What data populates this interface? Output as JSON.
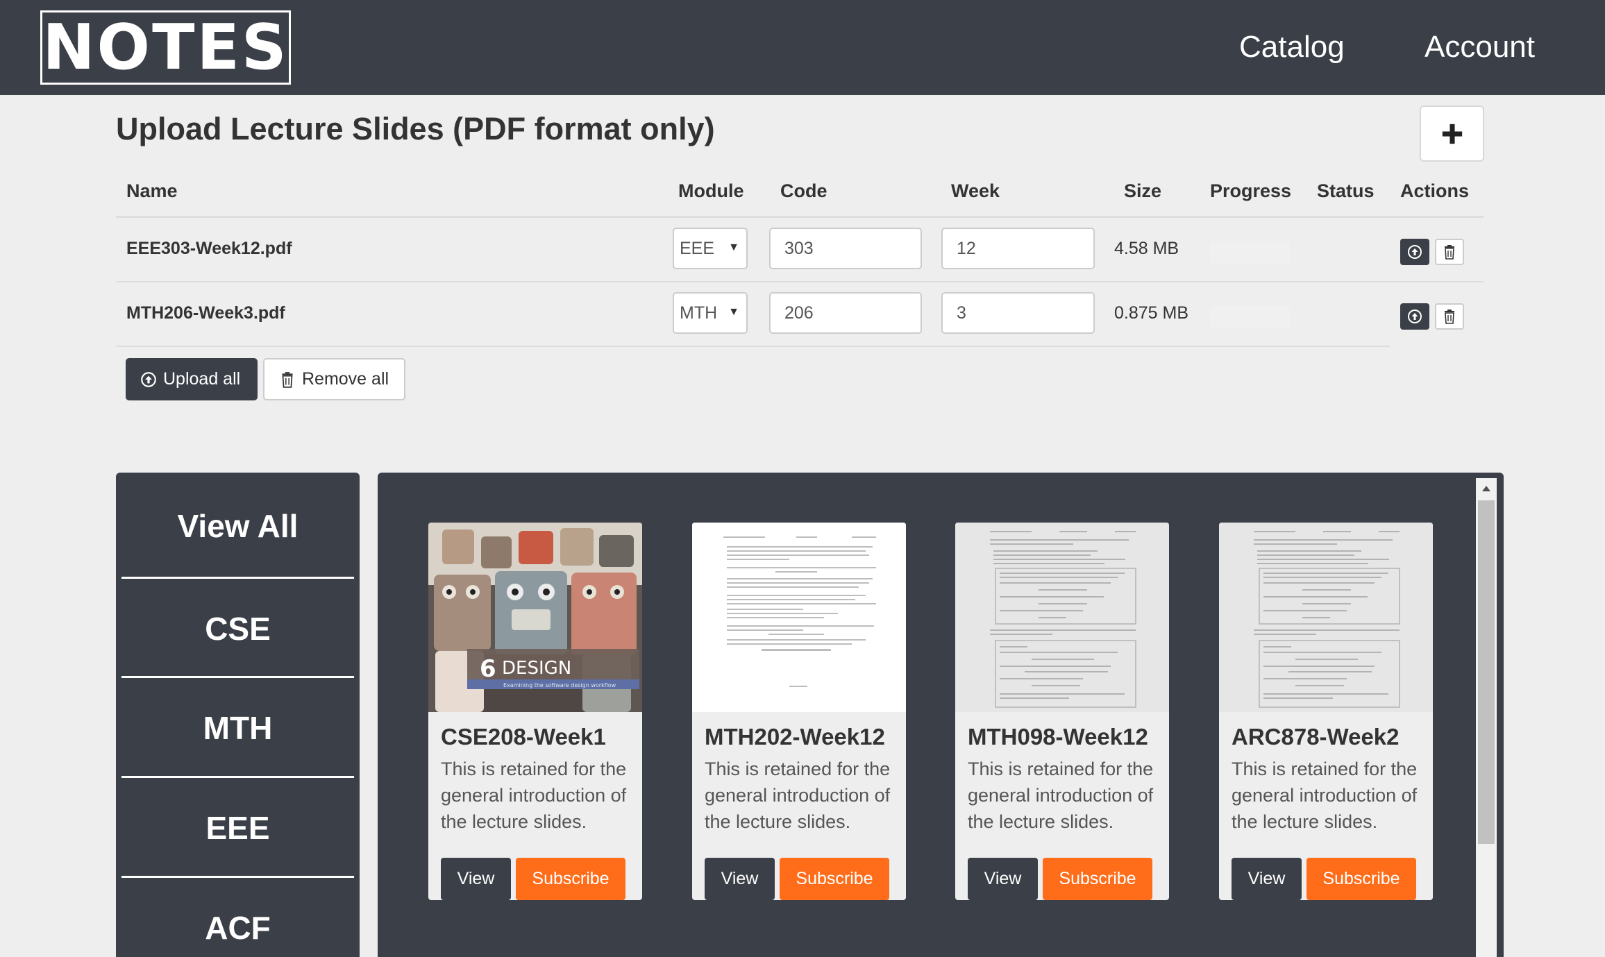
{
  "header": {
    "logo": "NOTES",
    "nav": [
      "Catalog",
      "Account"
    ]
  },
  "upload": {
    "title": "Upload Lecture Slides (PDF format only)",
    "columns": [
      "Name",
      "Module",
      "Code",
      "Week",
      "Size",
      "Progress",
      "Status",
      "Actions"
    ],
    "rows": [
      {
        "name": "EEE303-Week12.pdf",
        "module": "EEE",
        "code": "303",
        "week": "12",
        "size": "4.58 MB",
        "progress": 0,
        "status": ""
      },
      {
        "name": "MTH206-Week3.pdf",
        "module": "MTH",
        "code": "206",
        "week": "3",
        "size": "0.875 MB",
        "progress": 0,
        "status": ""
      }
    ],
    "upload_all": "Upload all",
    "remove_all": "Remove all"
  },
  "sidebar": {
    "items": [
      "View All",
      "CSE",
      "MTH",
      "EEE",
      "ACF"
    ]
  },
  "cards": [
    {
      "title": "CSE208-Week1",
      "desc": "This is retained for the general introduction of the lecture slides.",
      "thumb_label": "6",
      "thumb_text": "DESIGN",
      "thumb_sub": "Examining the software design workflow"
    },
    {
      "title": "MTH202-Week12",
      "desc": "This is retained for the general introduction of the lecture slides."
    },
    {
      "title": "MTH098-Week12",
      "desc": "This is retained for the general introduction of the lecture slides."
    },
    {
      "title": "ARC878-Week2",
      "desc": "This is retained for the general introduction of the lecture slides."
    }
  ],
  "card_buttons": {
    "view": "View",
    "subscribe": "Subscribe"
  },
  "colors": {
    "dark": "#3b3f47",
    "accent": "#ff6d1a",
    "background": "#eeeeee"
  }
}
